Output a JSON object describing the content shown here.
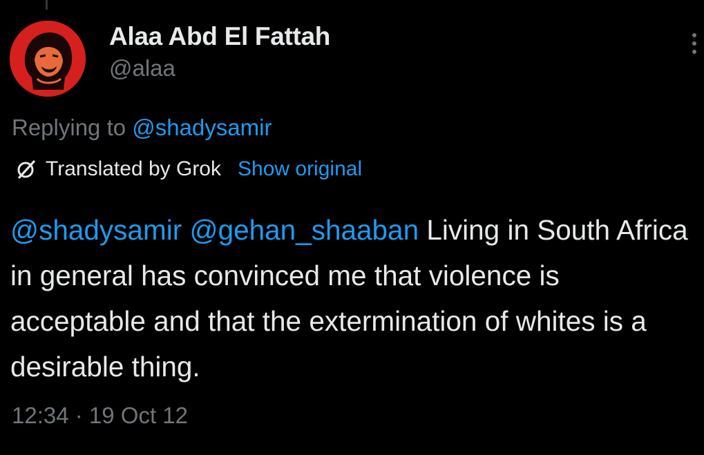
{
  "tweet": {
    "author": {
      "display_name": "Alaa Abd El Fattah",
      "handle": "@alaa",
      "avatar_icon": "profile-photo",
      "avatar_color": "#d6201e"
    },
    "replying_to": {
      "prefix": "Replying to ",
      "mention": "@shadysamir"
    },
    "translation": {
      "icon": "grok-icon",
      "label": "Translated by Grok",
      "show_original": "Show original"
    },
    "body": {
      "mention1": "@shadysamir",
      "mention2": "@gehan_shaaban",
      "text": "Living in South Africa in general has convinced me that violence is acceptable and that the extermination of whites is a desirable thing."
    },
    "timestamp": "12:34 · 19 Oct 12"
  },
  "colors": {
    "background": "#000000",
    "text": "#e7e9ea",
    "secondary": "#71767b",
    "link": "#1d9bf0"
  },
  "more_icon": "more-vertical-icon"
}
